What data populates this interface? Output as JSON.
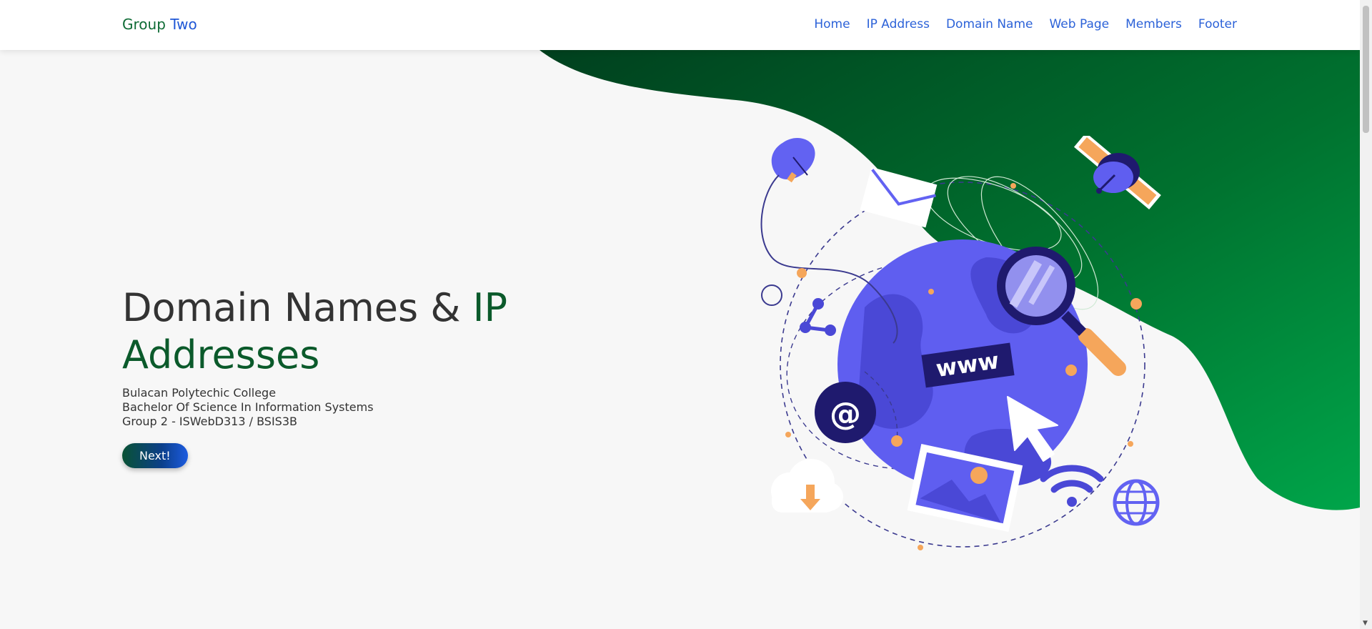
{
  "navbar": {
    "brand_main": "Group ",
    "brand_accent": "Two",
    "links": [
      "Home",
      "IP Address",
      "Domain Name",
      "Web Page",
      "Members",
      "Footer"
    ]
  },
  "hero": {
    "title_main": "Domain Names & ",
    "title_accent_1": "IP",
    "title_accent_2": "Addresses",
    "lines": [
      "Bulacan Polytechic College",
      "Bachelor Of Science In Information Systems",
      "Group 2 - ISWebD313 / BSIS3B"
    ],
    "button_label": "Next!"
  },
  "illustration": {
    "www_label": "www",
    "at_label": "@"
  },
  "colors": {
    "brand_green": "#0e6b35",
    "nav_blue": "#2c62d8",
    "globe_blue": "#5f5ef0",
    "deep_navy": "#1f1a6e",
    "accent_orange": "#f5a65b",
    "blob_dark": "#004d24",
    "blob_light": "#00a04a"
  }
}
